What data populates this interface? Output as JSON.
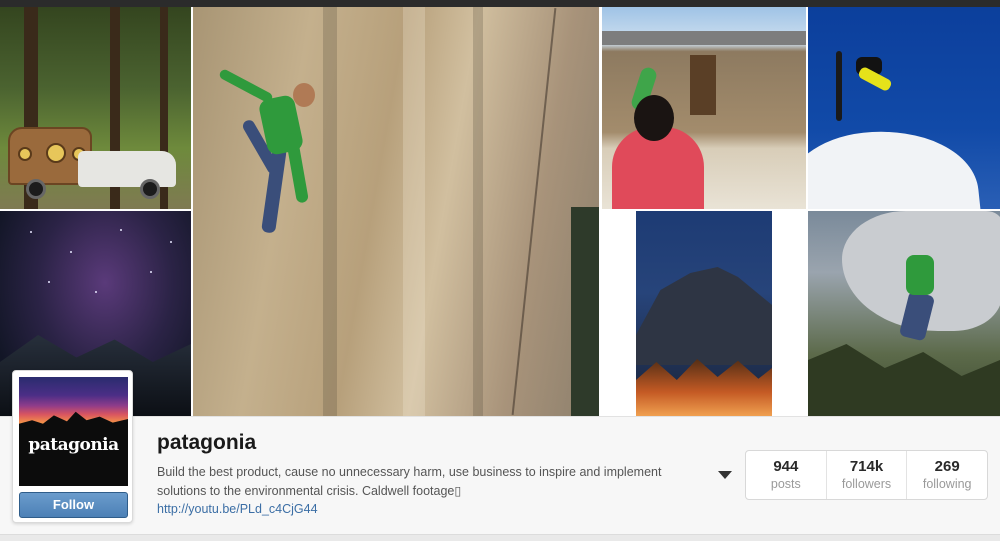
{
  "profile": {
    "username": "patagonia",
    "bio": "Build the best product, cause no unnecessary harm, use business to inspire and implement solutions to the environmental crisis. Caldwell footage▯",
    "link": "http://youtu.be/PLd_c4CjG44",
    "follow_label": "Follow",
    "logo_text": "patagonia"
  },
  "stats": [
    {
      "count": "944",
      "label": "posts"
    },
    {
      "count": "714k",
      "label": "followers"
    },
    {
      "count": "269",
      "label": "following"
    }
  ],
  "colors": {
    "follow_button": "#4c80b6",
    "link": "#3b6ea5",
    "top_bar": "#2b2b2b"
  },
  "icons": {
    "dropdown": "caret-down-icon"
  }
}
